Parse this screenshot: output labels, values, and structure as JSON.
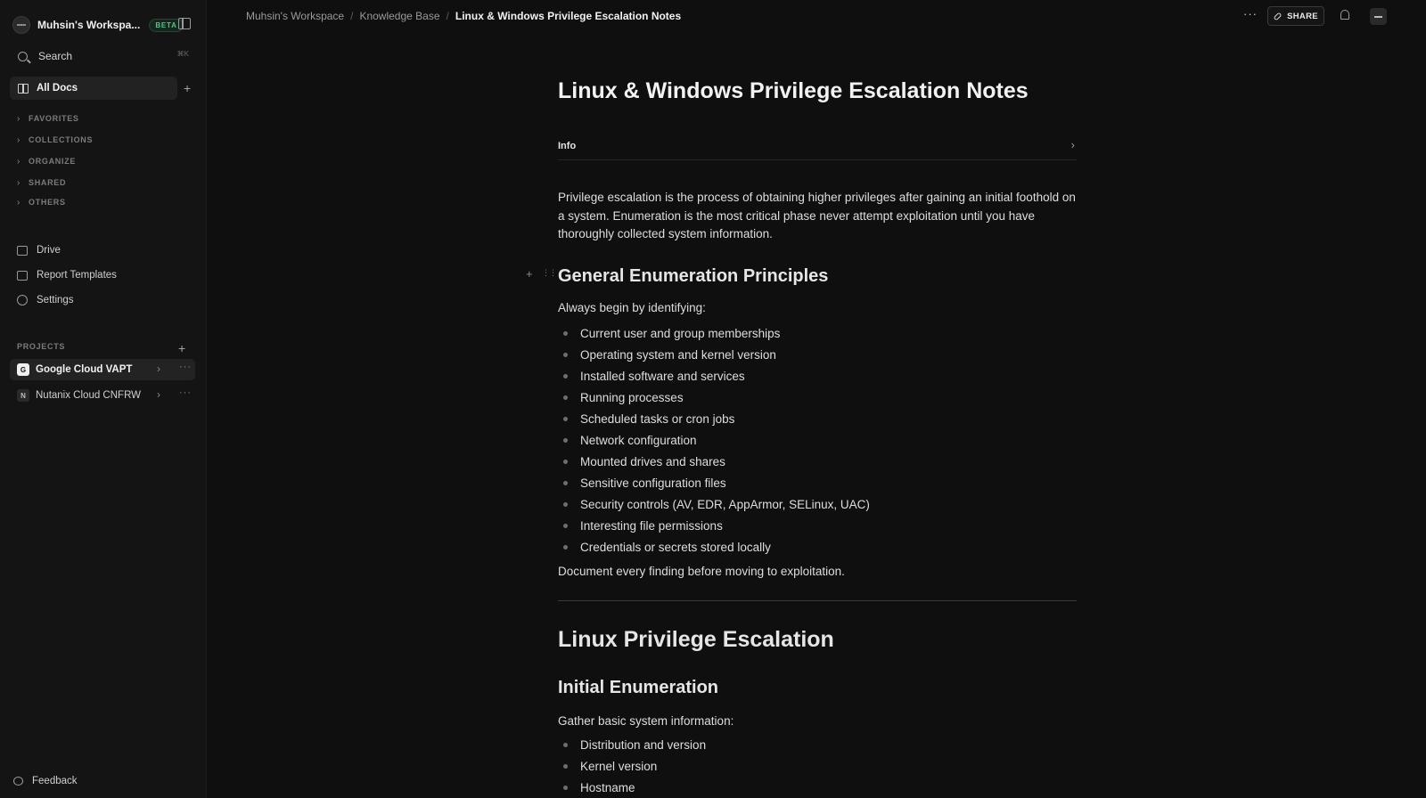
{
  "sidebar": {
    "workspace_name": "Muhsin's Workspa...",
    "beta_label": "BETA",
    "search_label": "Search",
    "search_shortcut": "⌘K",
    "all_docs_label": "All Docs",
    "sections": [
      "FAVORITES",
      "COLLECTIONS",
      "ORGANIZE",
      "SHARED",
      "OTHERS"
    ],
    "nav_items": [
      {
        "label": "Drive",
        "icon": "drive-icon"
      },
      {
        "label": "Report Templates",
        "icon": "templates-icon"
      },
      {
        "label": "Settings",
        "icon": "settings-icon"
      }
    ],
    "projects_label": "PROJECTS",
    "projects": [
      {
        "badge": "G",
        "label": "Google Cloud VAPT",
        "active": true
      },
      {
        "badge": "N",
        "label": "Nutanix Cloud CNFRW",
        "active": false
      }
    ],
    "feedback_label": "Feedback"
  },
  "topbar": {
    "breadcrumbs": [
      "Muhsin's Workspace",
      "Knowledge Base",
      "Linux & Windows Privilege Escalation Notes"
    ],
    "share_label": "SHARE"
  },
  "doc": {
    "title": "Linux & Windows Privilege Escalation Notes",
    "info_label": "Info",
    "intro": "Privilege escalation is the process of obtaining higher privileges after gaining an initial foothold on a system. Enumeration is the most critical phase never attempt exploitation until you have thoroughly collected system information.",
    "section1_heading": "General Enumeration Principles",
    "section1_lead": "Always begin by identifying:",
    "section1_items": [
      "Current user and group memberships",
      "Operating system and kernel version",
      "Installed software and services",
      "Running processes",
      "Scheduled tasks or cron jobs",
      "Network configuration",
      "Mounted drives and shares",
      "Sensitive configuration files",
      "Security controls (AV, EDR, AppArmor, SELinux, UAC)",
      "Interesting file permissions",
      "Credentials or secrets stored locally"
    ],
    "section1_footer": "Document every finding before moving to exploitation.",
    "section2_heading": "Linux Privilege Escalation",
    "section3_heading": "Initial Enumeration",
    "section3_lead": "Gather basic system information:",
    "section3_items": [
      "Distribution and version",
      "Kernel version",
      "Hostname"
    ]
  },
  "colors": {
    "background": "#0f0f0f",
    "sidebar": "#141414",
    "beta_accent": "#4fc38a"
  }
}
